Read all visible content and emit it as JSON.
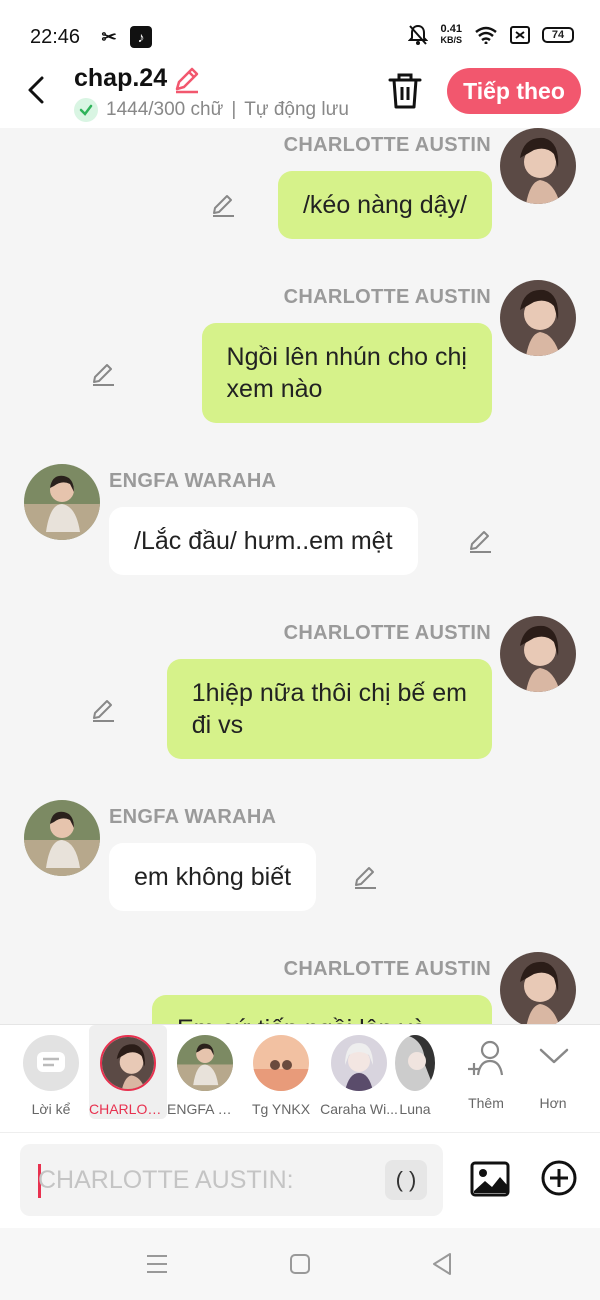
{
  "status_bar": {
    "time": "22:46",
    "net_speed_value": "0.41",
    "net_speed_unit": "KB/S",
    "battery": "74"
  },
  "header": {
    "title": "chap.24",
    "word_count": "1444/300 chữ",
    "separator": "|",
    "autosave": "Tự động lưu",
    "next_label": "Tiếp theo"
  },
  "messages": [
    {
      "side": "right",
      "name": "CHARLOTTE AUSTIN",
      "text_lines": [
        "/kéo nàng dậy/"
      ]
    },
    {
      "side": "right",
      "name": "CHARLOTTE AUSTIN",
      "text_lines": [
        "Ngồi lên nhún cho chị",
        "xem nào"
      ]
    },
    {
      "side": "left",
      "name": "ENGFA WARAHA",
      "text_lines": [
        "/Lắc đầu/ hưm..em mệt"
      ]
    },
    {
      "side": "right",
      "name": "CHARLOTTE AUSTIN",
      "text_lines": [
        "1hiệp nữa thôi chị bế em",
        "đi vs"
      ]
    },
    {
      "side": "left",
      "name": "ENGFA WARAHA",
      "text_lines": [
        "em không biết"
      ]
    },
    {
      "side": "right",
      "name": "CHARLOTTE AUSTIN",
      "text_lines": [
        "Em cứ tiếp ngồi lên và"
      ]
    }
  ],
  "characters": [
    {
      "label": "Lời kể",
      "icon": "narration-icon"
    },
    {
      "label": "CHARLOTTE AUSTIN",
      "selected": true
    },
    {
      "label": "ENGFA WARAHA"
    },
    {
      "label": "Tg YNKX"
    },
    {
      "label": "Caraha Wi..."
    },
    {
      "label": "Luna"
    },
    {
      "label": "Thêm",
      "icon": "add-person-icon"
    },
    {
      "label": "Hơn",
      "icon": "chevron-down-icon"
    }
  ],
  "composer": {
    "placeholder": "CHARLOTTE AUSTIN:",
    "paren_label": "( )"
  },
  "colors": {
    "accent": "#f2576e",
    "bubble_green": "#d6f28a",
    "selected_red": "#e8314f"
  }
}
